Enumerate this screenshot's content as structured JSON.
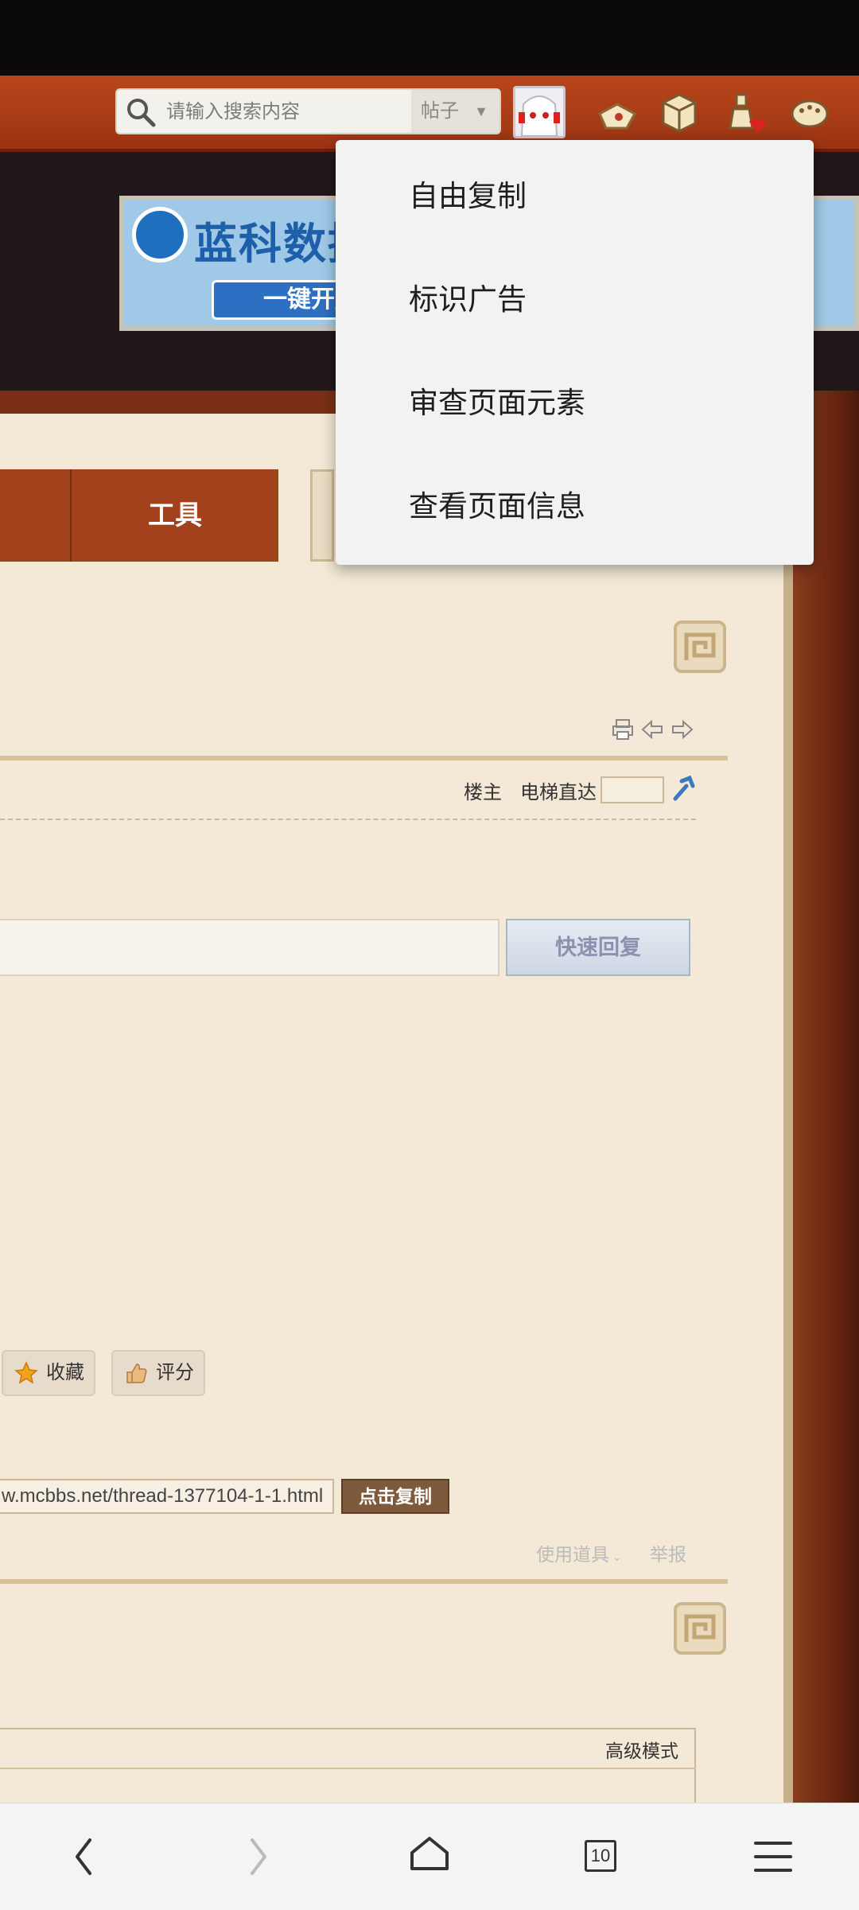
{
  "search": {
    "placeholder": "请输入搜索内容",
    "type": "帖子"
  },
  "nav": {
    "tools_label": "工具"
  },
  "banner": {
    "title": "蓝科数据",
    "subtitle": "一键开服"
  },
  "thread": {
    "floor_owner": "楼主",
    "elevator": "电梯直达",
    "quick_reply": "快速回复",
    "favorite": "收藏",
    "rate": "评分",
    "url": "w.mcbbs.net/thread-1377104-1-1.html",
    "copy": "点击复制",
    "use_tool": "使用道具",
    "report": "举报",
    "advanced_mode": "高级模式"
  },
  "menu": {
    "items": [
      "自由复制",
      "标识广告",
      "审查页面元素",
      "查看页面信息"
    ]
  },
  "bottom_nav": {
    "tabs_count": "10"
  },
  "colors": {
    "header": "#a23d17",
    "page_bg": "#f3e9d6",
    "menu_bg": "#f2f2f2"
  }
}
